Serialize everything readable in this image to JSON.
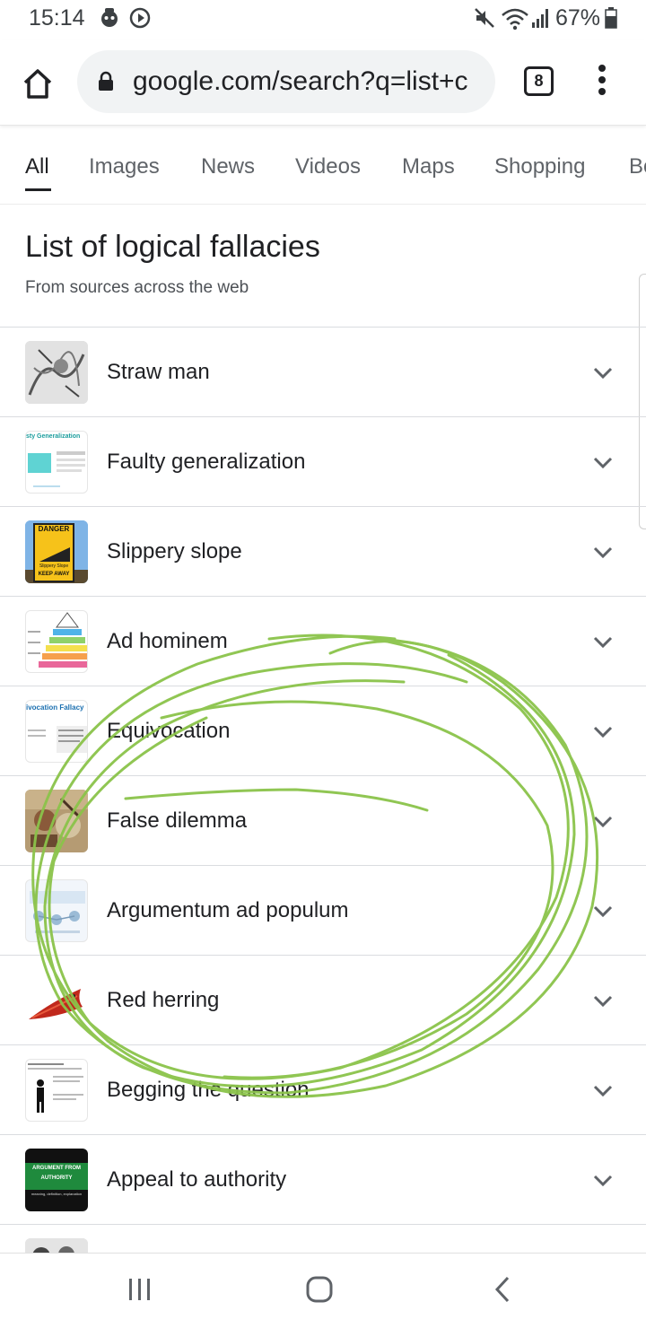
{
  "status_bar": {
    "time": "15:14",
    "battery": "67%",
    "icons": [
      "sticker-icon",
      "media-play-icon",
      "mute-icon",
      "wifi-icon",
      "signal-icon",
      "battery-icon"
    ]
  },
  "browser": {
    "url": "google.com/search?q=list+c",
    "tab_count": "8"
  },
  "search_tabs": [
    {
      "label": "All",
      "active": true
    },
    {
      "label": "Images"
    },
    {
      "label": "News"
    },
    {
      "label": "Videos"
    },
    {
      "label": "Maps"
    },
    {
      "label": "Shopping"
    },
    {
      "label": "Bo"
    }
  ],
  "list": {
    "title": "List of logical fallacies",
    "subtitle": "From sources across the web",
    "items": [
      {
        "label": "Straw man",
        "thumb": "engraving-image"
      },
      {
        "label": "Faulty generalization",
        "thumb": "slide-image"
      },
      {
        "label": "Slippery slope",
        "thumb": "danger-sign-image"
      },
      {
        "label": "Ad hominem",
        "thumb": "pyramid-chart-image"
      },
      {
        "label": "Equivocation",
        "thumb": "slide-image"
      },
      {
        "label": "False dilemma",
        "thumb": "painting-image"
      },
      {
        "label": "Argumentum ad populum",
        "thumb": "diagram-image"
      },
      {
        "label": "Red herring",
        "thumb": "fish-image"
      },
      {
        "label": "Begging the question",
        "thumb": "slide-image"
      },
      {
        "label": "Appeal to authority",
        "thumb": "title-card-image"
      }
    ],
    "appeal_thumb_text": {
      "line1": "ARGUMENT FROM",
      "line2": "AUTHORITY",
      "line3": "meaning, definition, explanation"
    },
    "danger_thumb_text": {
      "line1": "DANGER",
      "line2": "Slippery Slope",
      "line3": "KEEP AWAY"
    },
    "faulty_thumb_text": "sty Generalization",
    "equivocation_thumb_text": "ivocation Fallacy"
  },
  "colors": {
    "scribble": "#8bc34a",
    "chevron": "#5f6368"
  }
}
